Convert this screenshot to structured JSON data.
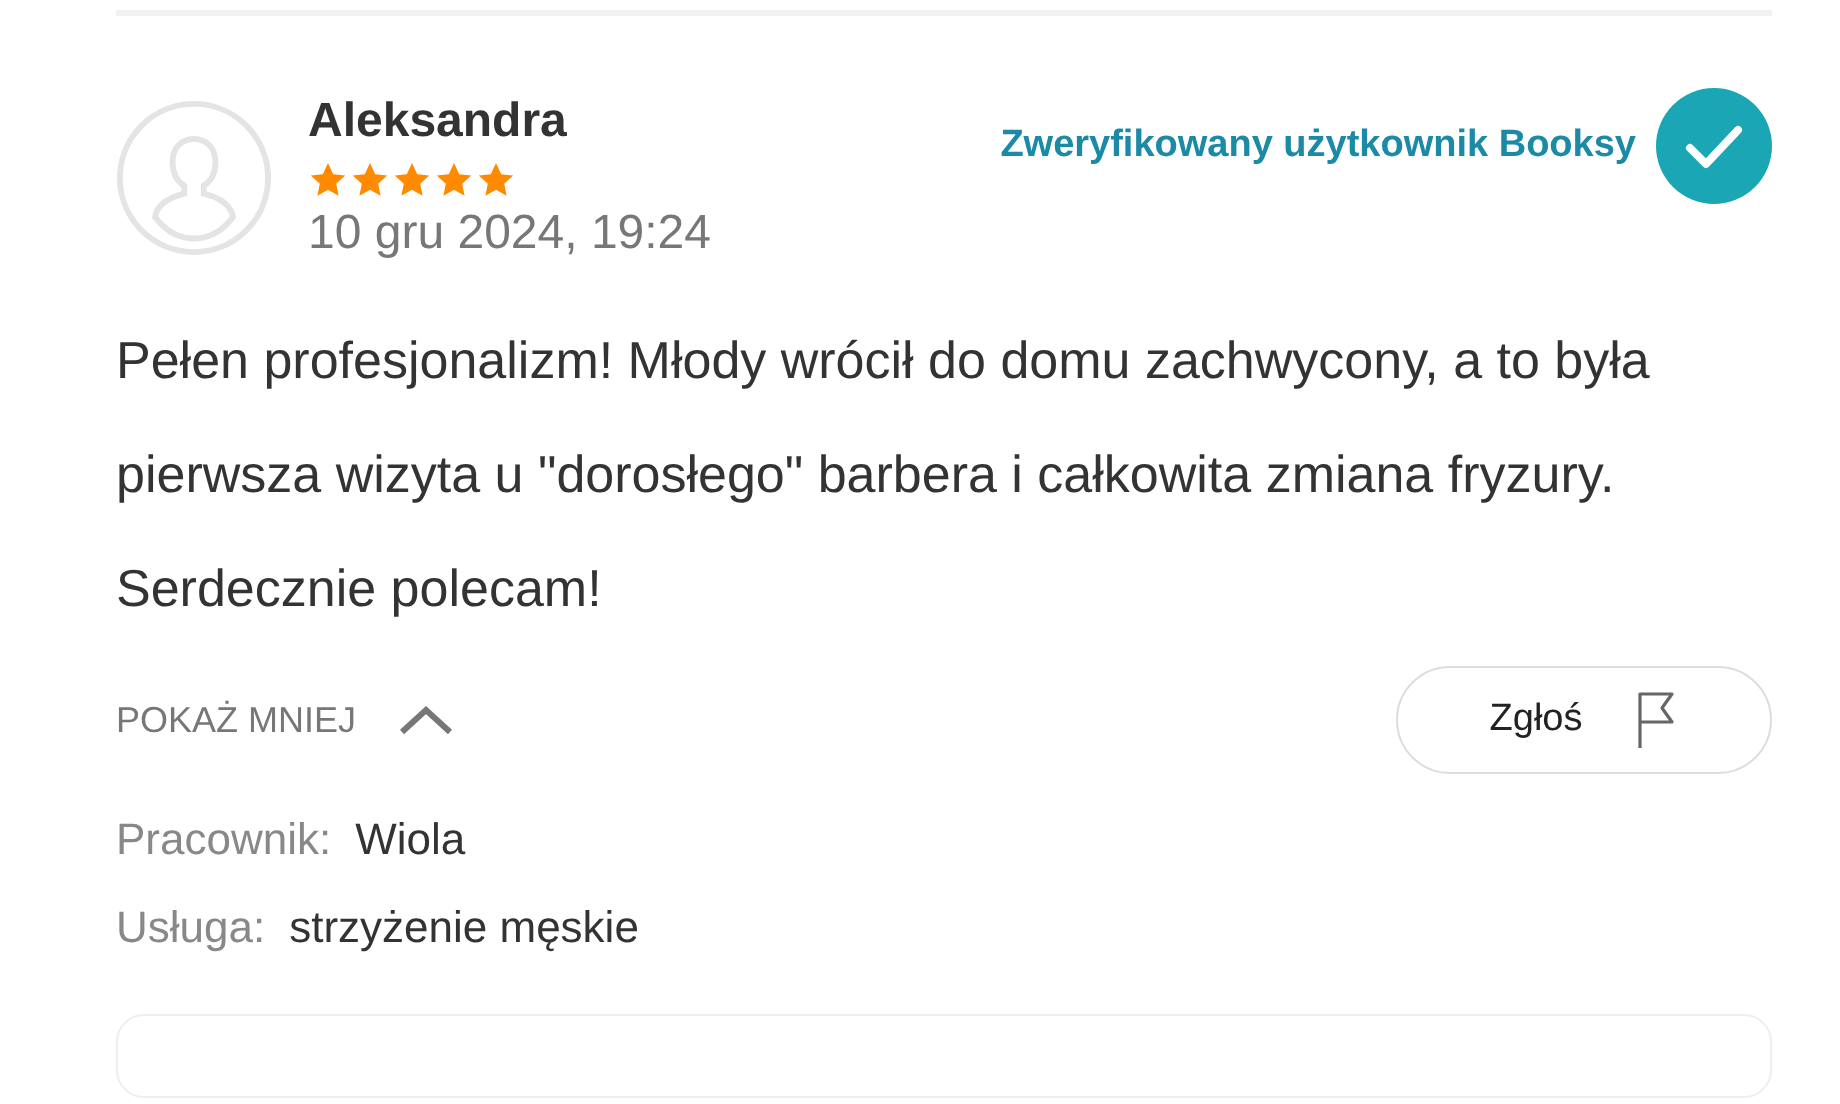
{
  "review": {
    "author": "Aleksandra",
    "stars": 5,
    "date": "10 gru 2024, 19:24",
    "verified": {
      "label": "Zweryfikowany użytkownik Booksy",
      "checked": true
    },
    "text": "Pełen profesjonalizm! Młody wrócił do domu zachwycony, a to była pierwsza wizyta u \"dorosłego\" barbera i całkowita zmiana fryzury. Serdecznie polecam!",
    "toggle": {
      "label": "POKAŻ MNIEJ",
      "expanded": true
    },
    "report_button": "Zgłoś",
    "details": [
      {
        "label": "Pracownik:",
        "value": "Wiola"
      },
      {
        "label": "Usługa:",
        "value": "strzyżenie męskie"
      }
    ]
  }
}
